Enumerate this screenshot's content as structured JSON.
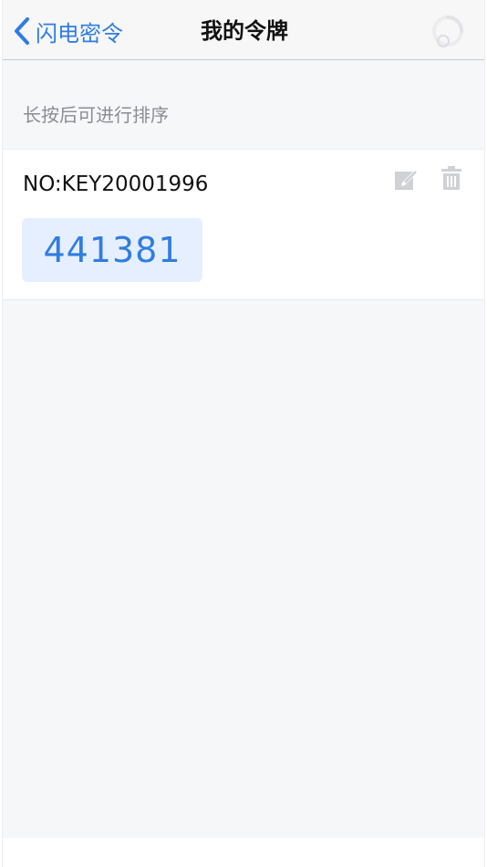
{
  "nav": {
    "back_label": "闪电密令",
    "title": "我的令牌"
  },
  "hint": "长按后可进行排序",
  "tokens": [
    {
      "id_label": "NO:KEY20001996",
      "code": "441381"
    }
  ],
  "icons": {
    "back": "chevron-left-icon",
    "loading": "loading-icon",
    "edit": "edit-icon",
    "delete": "trash-icon"
  },
  "colors": {
    "accent": "#2f7de1",
    "code_bg": "#e6efff",
    "page_bg": "#f6f7f9",
    "icon_gray": "#cfd1d5"
  }
}
